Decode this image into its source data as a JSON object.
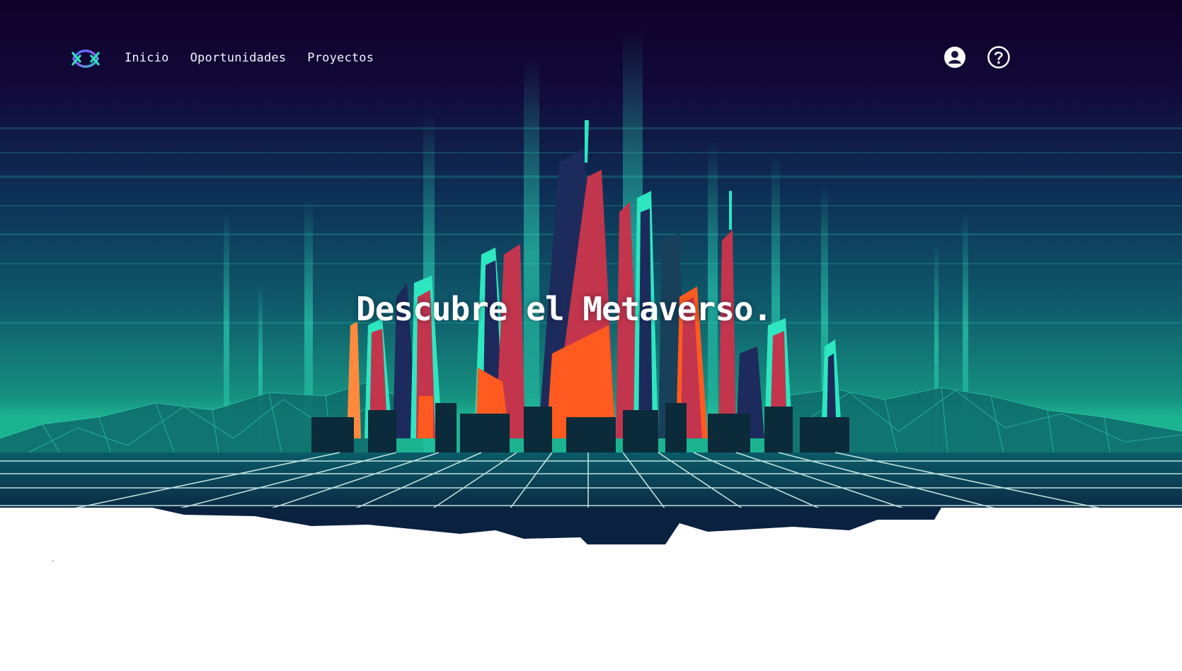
{
  "nav": {
    "logo_icon": "metaverse-loop-logo-icon",
    "links": [
      {
        "label": "Inicio"
      },
      {
        "label": "Oportunidades"
      },
      {
        "label": "Proyectos"
      }
    ],
    "account_icon": "user-circle-icon",
    "help_icon": "question-circle-icon"
  },
  "hero": {
    "headline": "Descubre el Metaverso.",
    "illustration": "neon-futuristic-city-skyline",
    "colors": {
      "sky_top": "#10002b",
      "sky_mid": "#0b3a5e",
      "horizon": "#16a98f",
      "neon": "#2ee6c0",
      "tower_red": "#c2354d",
      "tower_orange": "#ff5a1f",
      "tower_navy": "#1d2a5c"
    }
  }
}
